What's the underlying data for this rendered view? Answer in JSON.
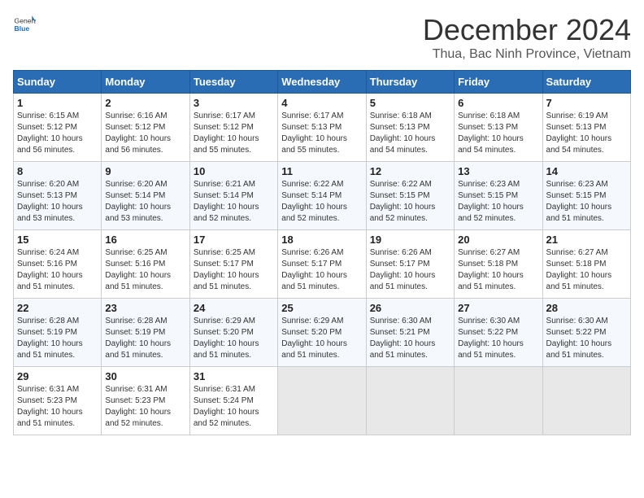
{
  "header": {
    "logo_general": "General",
    "logo_blue": "Blue",
    "month_title": "December 2024",
    "location": "Thua, Bac Ninh Province, Vietnam"
  },
  "weekdays": [
    "Sunday",
    "Monday",
    "Tuesday",
    "Wednesday",
    "Thursday",
    "Friday",
    "Saturday"
  ],
  "weeks": [
    [
      {
        "day": "1",
        "sunrise": "6:15 AM",
        "sunset": "5:12 PM",
        "daylight": "10 hours and 56 minutes."
      },
      {
        "day": "2",
        "sunrise": "6:16 AM",
        "sunset": "5:12 PM",
        "daylight": "10 hours and 56 minutes."
      },
      {
        "day": "3",
        "sunrise": "6:17 AM",
        "sunset": "5:12 PM",
        "daylight": "10 hours and 55 minutes."
      },
      {
        "day": "4",
        "sunrise": "6:17 AM",
        "sunset": "5:13 PM",
        "daylight": "10 hours and 55 minutes."
      },
      {
        "day": "5",
        "sunrise": "6:18 AM",
        "sunset": "5:13 PM",
        "daylight": "10 hours and 54 minutes."
      },
      {
        "day": "6",
        "sunrise": "6:18 AM",
        "sunset": "5:13 PM",
        "daylight": "10 hours and 54 minutes."
      },
      {
        "day": "7",
        "sunrise": "6:19 AM",
        "sunset": "5:13 PM",
        "daylight": "10 hours and 54 minutes."
      }
    ],
    [
      {
        "day": "8",
        "sunrise": "6:20 AM",
        "sunset": "5:13 PM",
        "daylight": "10 hours and 53 minutes."
      },
      {
        "day": "9",
        "sunrise": "6:20 AM",
        "sunset": "5:14 PM",
        "daylight": "10 hours and 53 minutes."
      },
      {
        "day": "10",
        "sunrise": "6:21 AM",
        "sunset": "5:14 PM",
        "daylight": "10 hours and 52 minutes."
      },
      {
        "day": "11",
        "sunrise": "6:22 AM",
        "sunset": "5:14 PM",
        "daylight": "10 hours and 52 minutes."
      },
      {
        "day": "12",
        "sunrise": "6:22 AM",
        "sunset": "5:15 PM",
        "daylight": "10 hours and 52 minutes."
      },
      {
        "day": "13",
        "sunrise": "6:23 AM",
        "sunset": "5:15 PM",
        "daylight": "10 hours and 52 minutes."
      },
      {
        "day": "14",
        "sunrise": "6:23 AM",
        "sunset": "5:15 PM",
        "daylight": "10 hours and 51 minutes."
      }
    ],
    [
      {
        "day": "15",
        "sunrise": "6:24 AM",
        "sunset": "5:16 PM",
        "daylight": "10 hours and 51 minutes."
      },
      {
        "day": "16",
        "sunrise": "6:25 AM",
        "sunset": "5:16 PM",
        "daylight": "10 hours and 51 minutes."
      },
      {
        "day": "17",
        "sunrise": "6:25 AM",
        "sunset": "5:17 PM",
        "daylight": "10 hours and 51 minutes."
      },
      {
        "day": "18",
        "sunrise": "6:26 AM",
        "sunset": "5:17 PM",
        "daylight": "10 hours and 51 minutes."
      },
      {
        "day": "19",
        "sunrise": "6:26 AM",
        "sunset": "5:17 PM",
        "daylight": "10 hours and 51 minutes."
      },
      {
        "day": "20",
        "sunrise": "6:27 AM",
        "sunset": "5:18 PM",
        "daylight": "10 hours and 51 minutes."
      },
      {
        "day": "21",
        "sunrise": "6:27 AM",
        "sunset": "5:18 PM",
        "daylight": "10 hours and 51 minutes."
      }
    ],
    [
      {
        "day": "22",
        "sunrise": "6:28 AM",
        "sunset": "5:19 PM",
        "daylight": "10 hours and 51 minutes."
      },
      {
        "day": "23",
        "sunrise": "6:28 AM",
        "sunset": "5:19 PM",
        "daylight": "10 hours and 51 minutes."
      },
      {
        "day": "24",
        "sunrise": "6:29 AM",
        "sunset": "5:20 PM",
        "daylight": "10 hours and 51 minutes."
      },
      {
        "day": "25",
        "sunrise": "6:29 AM",
        "sunset": "5:20 PM",
        "daylight": "10 hours and 51 minutes."
      },
      {
        "day": "26",
        "sunrise": "6:30 AM",
        "sunset": "5:21 PM",
        "daylight": "10 hours and 51 minutes."
      },
      {
        "day": "27",
        "sunrise": "6:30 AM",
        "sunset": "5:22 PM",
        "daylight": "10 hours and 51 minutes."
      },
      {
        "day": "28",
        "sunrise": "6:30 AM",
        "sunset": "5:22 PM",
        "daylight": "10 hours and 51 minutes."
      }
    ],
    [
      {
        "day": "29",
        "sunrise": "6:31 AM",
        "sunset": "5:23 PM",
        "daylight": "10 hours and 51 minutes."
      },
      {
        "day": "30",
        "sunrise": "6:31 AM",
        "sunset": "5:23 PM",
        "daylight": "10 hours and 52 minutes."
      },
      {
        "day": "31",
        "sunrise": "6:31 AM",
        "sunset": "5:24 PM",
        "daylight": "10 hours and 52 minutes."
      },
      null,
      null,
      null,
      null
    ]
  ]
}
